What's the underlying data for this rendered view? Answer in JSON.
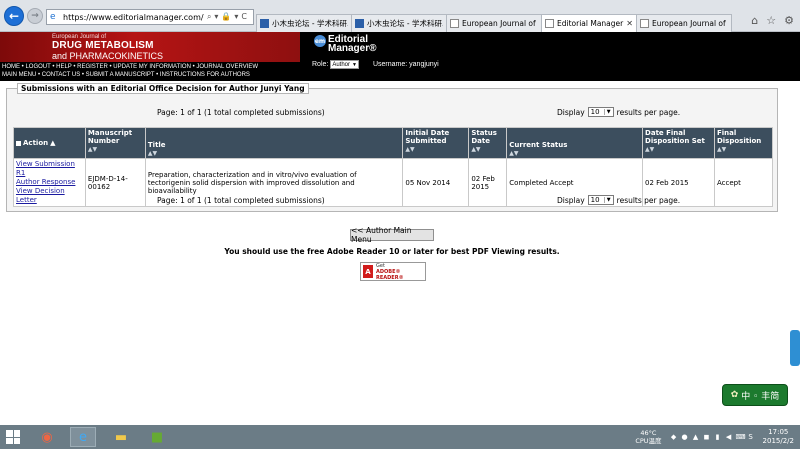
{
  "browser": {
    "url": "https://www.editorialmanager.com/ejdm/default.a",
    "tabs": [
      {
        "label": "小木虫论坛 - 学术科研..."
      },
      {
        "label": "小木虫论坛 - 学术科研..."
      },
      {
        "label": "European Journal of ..."
      },
      {
        "label": "Editorial Manager®",
        "active": true
      },
      {
        "label": "European Journal of ..."
      }
    ]
  },
  "journal": {
    "line1": "European Journal of",
    "line2": "DRUG METABOLISM",
    "line3": "and PHARMACOKINETICS"
  },
  "em_logo": {
    "badge": "em",
    "line1": "Editorial",
    "line2": "Manager®"
  },
  "header_menu": {
    "row1": [
      "HOME",
      "LOGOUT",
      "HELP",
      "REGISTER",
      "UPDATE MY INFORMATION",
      "JOURNAL OVERVIEW"
    ],
    "row2": [
      "MAIN MENU",
      "CONTACT US",
      "SUBMIT A MANUSCRIPT",
      "INSTRUCTIONS FOR AUTHORS"
    ],
    "sep": " • "
  },
  "role": {
    "label": "Role:",
    "value": "Author",
    "username_label": "Username: yangjunyi"
  },
  "submissions": {
    "legend": "Submissions with an Editorial Office Decision for Author Junyi Yang",
    "pages_text": "Page: 1 of 1 (1 total completed submissions)",
    "display_label": "Display",
    "per_page": "10",
    "per_page_suffix": "results per page.",
    "columns": {
      "action": "Action",
      "manuscript": "Manuscript Number",
      "title": "Title",
      "initial_date": "Initial Date Submitted",
      "status_date": "Status Date",
      "current_status": "Current Status",
      "final_date": "Date Final Disposition Set",
      "final_disp": "Final Disposition"
    },
    "sort_arrows": "▲▼",
    "row": {
      "links": [
        "View Submission R1",
        "Author Response",
        "View Decision Letter"
      ],
      "manuscript": "EJDM-D-14-00162",
      "title": "Preparation, characterization and in vitro/vivo evaluation of tectorigenin solid dispersion with improved dissolution and bioavailability",
      "initial_date": "05 Nov 2014",
      "status_date": "02 Feb 2015",
      "current_status": "Completed Accept",
      "final_date": "02 Feb 2015",
      "final_disp": "Accept"
    }
  },
  "main_menu_button": "<< Author Main Menu",
  "pdf_note": "You should use the free Adobe Reader 10 or later for best PDF Viewing results.",
  "adobe": {
    "line1": "Get",
    "line2": "ADOBE® READER®"
  },
  "ime": {
    "label": "中 ◦ 丰简"
  },
  "taskbar": {
    "temp": "46°C",
    "temp_label": "CPU温度",
    "time": "17:05",
    "date": "2015/2/2"
  }
}
